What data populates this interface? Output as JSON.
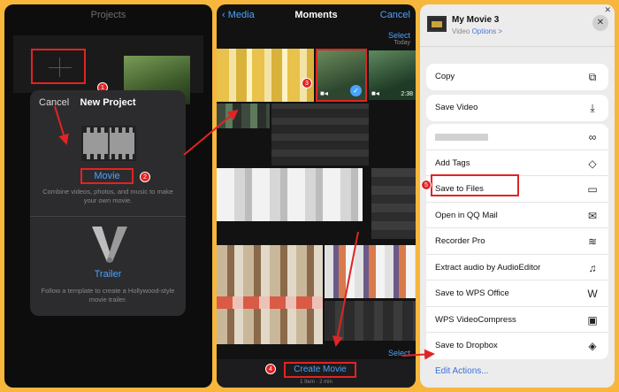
{
  "panel1": {
    "title": "Projects",
    "sheet": {
      "cancel": "Cancel",
      "title": "New Project",
      "movie_label": "Movie",
      "movie_desc": "Combine videos, photos, and music to make your own movie.",
      "trailer_label": "Trailer",
      "trailer_desc": "Follow a template to create a Hollywood-style movie trailer."
    },
    "badges": [
      "1",
      "2"
    ]
  },
  "panel2": {
    "back": "Media",
    "title": "Moments",
    "cancel": "Cancel",
    "select_top": "Select",
    "today": "Today",
    "clip_duration": "2:38",
    "select_bottom": "Select",
    "create_movie": "Create Movie",
    "sub_info": "1 Item · 2 min",
    "badges": [
      "3",
      "4"
    ]
  },
  "panel3": {
    "movie_name": "My Movie 3",
    "type": "Video",
    "options": "Options >",
    "group1": [
      {
        "label": "Copy",
        "icon": "copy-icon"
      }
    ],
    "group2": [
      {
        "label": "Save Video",
        "icon": "save-video-icon"
      }
    ],
    "group3": [
      {
        "label": "",
        "icon": "share-circles-icon"
      },
      {
        "label": "Add Tags",
        "icon": "tag-icon"
      },
      {
        "label": "Save to Files",
        "icon": "folder-icon"
      },
      {
        "label": "Open in QQ Mail",
        "icon": "mail-icon"
      },
      {
        "label": "Recorder Pro",
        "icon": "waveform-icon"
      },
      {
        "label": "Extract audio by AudioEditor",
        "icon": "music-note-icon"
      },
      {
        "label": "Save to WPS Office",
        "icon": "wps-icon"
      },
      {
        "label": "WPS VideoCompress",
        "icon": "video-compress-icon"
      },
      {
        "label": "Save to Dropbox",
        "icon": "dropbox-icon"
      }
    ],
    "edit_actions": "Edit Actions...",
    "badges": [
      "5"
    ]
  }
}
